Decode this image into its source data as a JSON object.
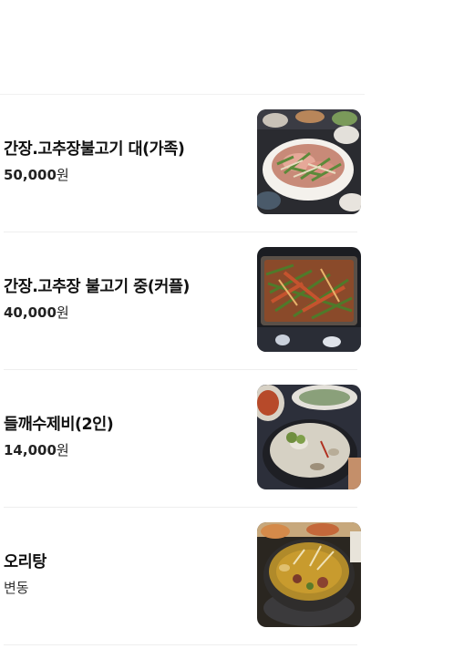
{
  "menu": {
    "items": [
      {
        "name": "간장.고추장불고기 대(가족)",
        "price_num": "50,000",
        "price_unit": "원",
        "photo": "bulgogi-large-photo"
      },
      {
        "name": "간장.고추장 불고기 중(커플)",
        "price_num": "40,000",
        "price_unit": "원",
        "photo": "bulgogi-medium-photo"
      },
      {
        "name": "들깨수제비(2인)",
        "price_num": "14,000",
        "price_unit": "원",
        "photo": "sujebi-photo"
      },
      {
        "name": "오리탕",
        "price_text": "변동",
        "photo": "duck-soup-photo"
      }
    ]
  },
  "colors": {
    "divider": "#eeeeee",
    "text": "#111111"
  }
}
